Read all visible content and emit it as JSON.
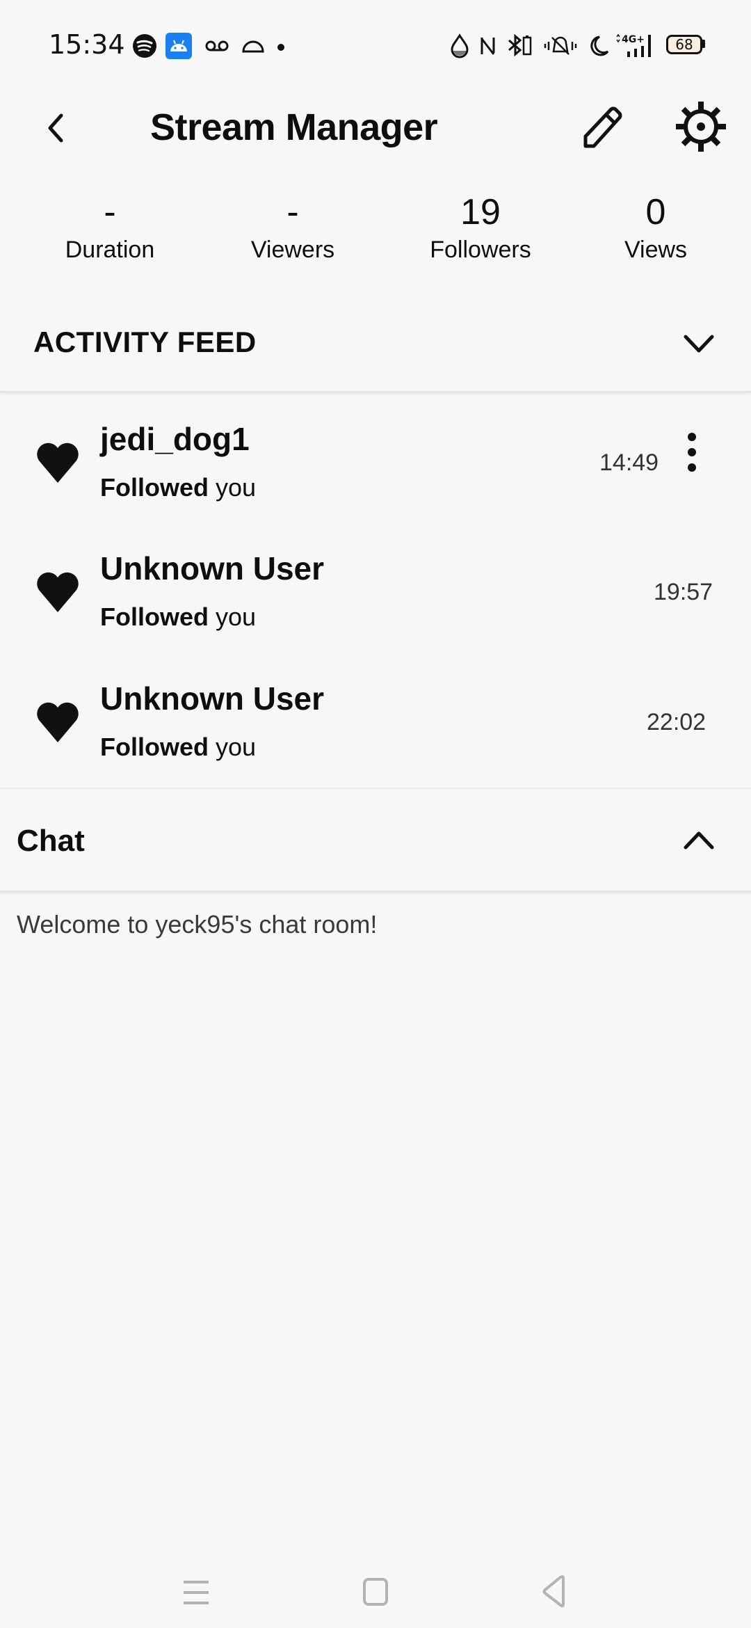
{
  "status_bar": {
    "time": "15:34",
    "battery": "68",
    "network": "4G+",
    "left_icons": [
      "spotify-icon",
      "android-icon",
      "voicemail-icon",
      "half-circle-icon",
      "dot-icon"
    ],
    "right_icons": [
      "drop-icon",
      "nfc-icon",
      "bluetooth-battery-icon",
      "vibrate-mute-icon",
      "moon-icon",
      "signal-icon",
      "battery-icon"
    ]
  },
  "app_bar": {
    "title": "Stream Manager",
    "back_icon": "chevron-left-icon",
    "edit_icon": "pencil-icon",
    "settings_icon": "gear-icon"
  },
  "stats": [
    {
      "value": "-",
      "label": "Duration"
    },
    {
      "value": "-",
      "label": "Viewers"
    },
    {
      "value": "19",
      "label": "Followers"
    },
    {
      "value": "0",
      "label": "Views"
    }
  ],
  "activity_feed": {
    "title": "ACTIVITY FEED",
    "toggle_icon": "chevron-down-icon",
    "items": [
      {
        "name": "jedi_dog1",
        "action": "Followed",
        "object": "you",
        "time": "14:49",
        "has_menu": true
      },
      {
        "name": "Unknown User",
        "action": "Followed",
        "object": "you",
        "time": "19:57",
        "has_menu": false
      },
      {
        "name": "Unknown User",
        "action": "Followed",
        "object": "you",
        "time": "22:02",
        "has_menu": false
      }
    ]
  },
  "chat": {
    "title": "Chat",
    "toggle_icon": "chevron-up-icon",
    "welcome_message": "Welcome to yeck95's chat room!"
  },
  "nav_bar": {
    "icons": [
      "menu-icon",
      "home-icon",
      "back-icon"
    ]
  }
}
